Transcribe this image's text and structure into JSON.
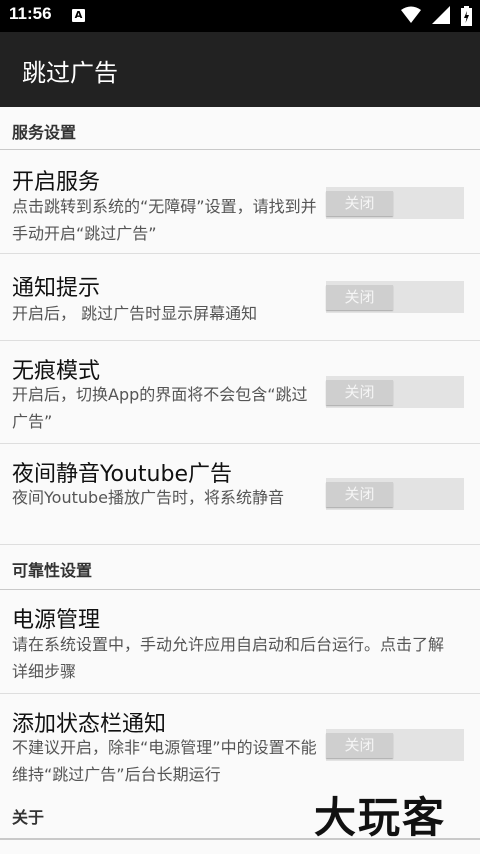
{
  "status_bar": {
    "time": "11:56",
    "notification_icon": "A"
  },
  "app_bar": {
    "title": "跳过广告"
  },
  "categories": {
    "service": "服务设置",
    "reliability": "可靠性设置",
    "about": "关于"
  },
  "prefs": {
    "open_service": {
      "title": "开启服务",
      "summary": "点击跳转到系统的“无障碍”设置，请找到并手动开启“跳过广告”",
      "switch": "关闭"
    },
    "notify": {
      "title": "通知提示",
      "summary": "开启后， 跳过广告时显示屏幕通知",
      "switch": "关闭"
    },
    "incognito": {
      "title": "无痕模式",
      "summary": "开启后，切换App的界面将不会包含“跳过广告”",
      "switch": "关闭"
    },
    "night_mute": {
      "title": "夜间静音Youtube广告",
      "summary": "夜间Youtube播放广告时，将系统静音",
      "switch": "关闭"
    },
    "power": {
      "title": "电源管理",
      "summary": "请在系统设置中，手动允许应用自启动和后台运行。点击了解详细步骤"
    },
    "status_notify": {
      "title": "添加状态栏通知",
      "summary": "不建议开启，除非“电源管理”中的设置不能维持“跳过广告”后台长期运行",
      "switch": "关闭"
    }
  },
  "watermark": "大玩客",
  "colors": {
    "app_bar": "#222222",
    "status_bar": "#000000",
    "switch_track": "#e3e3e3",
    "switch_thumb": "#cfcfcf"
  }
}
